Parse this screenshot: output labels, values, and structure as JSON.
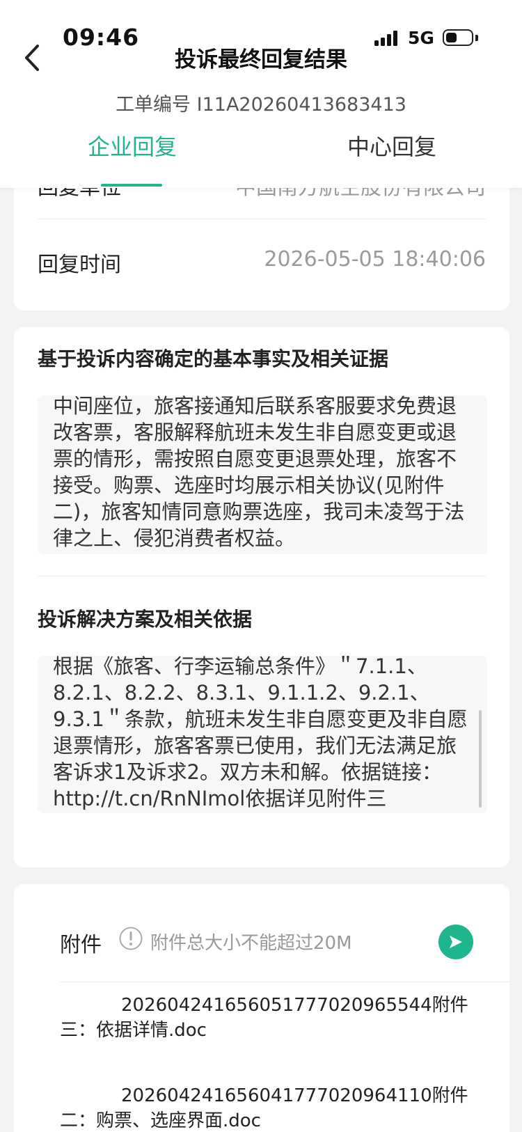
{
  "status_bar": {
    "time": "09:46",
    "network": "5G",
    "battery_level": 0.45
  },
  "header": {
    "title": "投诉最终回复结果",
    "order_number": "工单编号 I11A20260413683413",
    "tabs": [
      {
        "label": "企业回复",
        "active": true
      },
      {
        "label": "中心回复",
        "active": false
      }
    ]
  },
  "reply_info": {
    "unit_label": "回复单位",
    "unit_value": "中国南方航空股份有限公司",
    "time_label": "回复时间",
    "time_value": "2026-05-05 18:40:06"
  },
  "facts_section": {
    "title": "基于投诉内容确定的基本事实及相关证据",
    "text": "中间座位，旅客接通知后联系客服要求免费退改客票，客服解释航班未发生非自愿变更或退票的情形，需按照自愿变更退票处理，旅客不接受。购票、选座时均展示相关协议(见附件二)，旅客知情同意购票选座，我司未凌驾于法律之上、侵犯消费者权益。"
  },
  "solution_section": {
    "title": "投诉解决方案及相关依据",
    "text": "根据《旅客、行李运输总条件》＂7.1.1、8.2.1、8.2.2、8.3.1、9.1.1.2、9.2.1、9.3.1＂条款，航班未发生非自愿变更及非自愿退票情形，旅客客票已使用，我们无法满足旅客诉求1及诉求2。双方未和解。依据链接：http://t.cn/RnNImol依据详见附件三"
  },
  "attachments": {
    "label": "附件",
    "hint": "附件总大小不能超过20M",
    "files": [
      {
        "name": "20260424165605177702096554​4附件三：依据详情.doc"
      },
      {
        "name": "20260424165604177702096411​0附件二：购票、选座界面.doc"
      }
    ]
  },
  "colors": {
    "accent": "#1fb58f",
    "background": "#f2f3f5"
  },
  "icons": [
    "back-arrow-icon",
    "signal-icon",
    "battery-icon",
    "info-icon",
    "send-icon"
  ]
}
